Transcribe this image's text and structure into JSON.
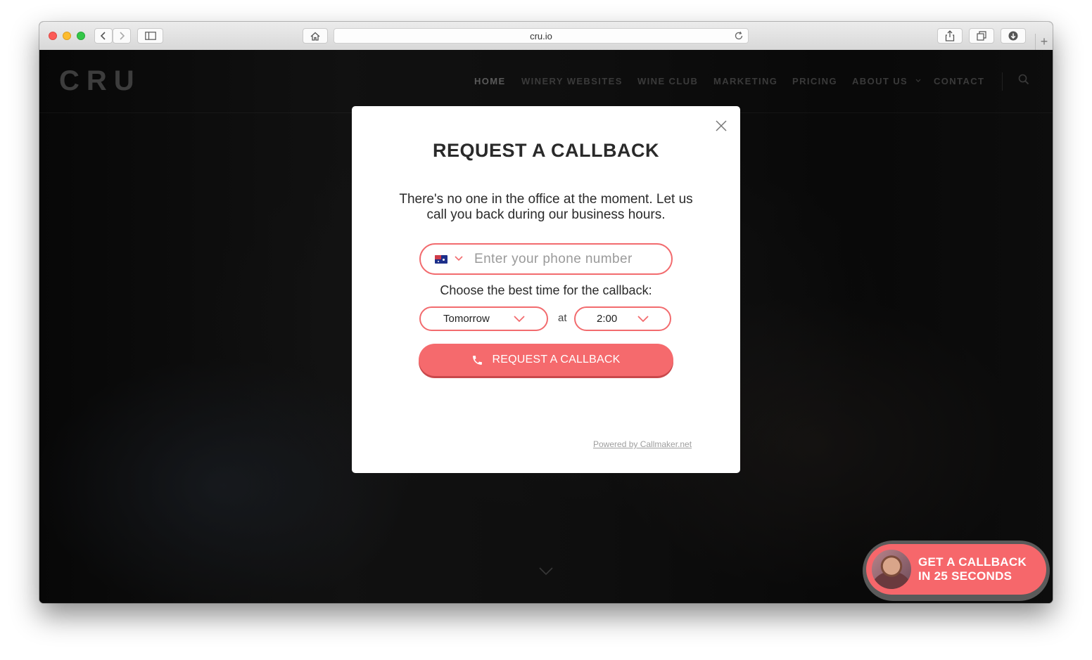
{
  "browser": {
    "url": "cru.io",
    "new_tab_glyph": "+"
  },
  "site": {
    "logo": "CRU",
    "nav": {
      "home": "HOME",
      "winery_websites": "WINERY WEBSITES",
      "wine_club": "WINE CLUB",
      "marketing": "MARKETING",
      "pricing": "PRICING",
      "about_us": "ABOUT US",
      "contact": "CONTACT"
    }
  },
  "modal": {
    "title": "REQUEST A CALLBACK",
    "message": "There's no one in the office at the moment. Let us call you back during our business hours.",
    "phone_placeholder": "Enter your phone number",
    "country_icon": "australia-flag-icon",
    "time_label": "Choose the best time for the callback:",
    "day_value": "Tomorrow",
    "at_label": "at",
    "time_value": "2:00",
    "button_label": "REQUEST A CALLBACK",
    "powered_by": "Powered by Callmaker.net"
  },
  "widget": {
    "line1": "GET A CALLBACK",
    "line2": "IN 25 SECONDS"
  },
  "colors": {
    "accent": "#f56a6d",
    "modal_bg": "#ffffff",
    "site_bg": "#0d0d0d"
  }
}
